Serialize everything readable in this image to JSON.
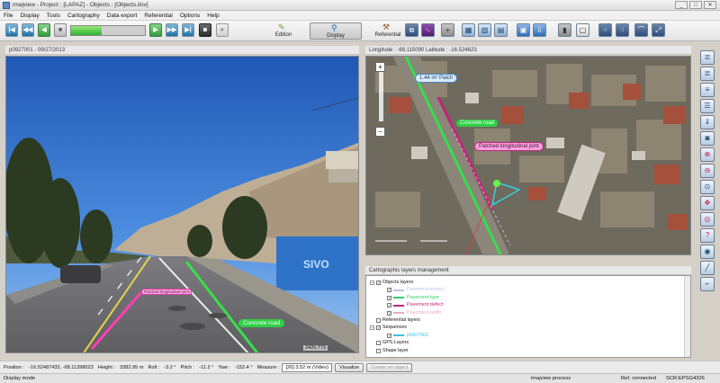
{
  "window": {
    "title": "imajview - Project : [LAPAZ] - Objects : [Objects.ilov]"
  },
  "menu": [
    "File",
    "Display",
    "Tools",
    "Cartography",
    "Data export",
    "Referential",
    "Options",
    "Help"
  ],
  "toolbar": {
    "progress": 0.42,
    "modes": [
      {
        "label": "Edition",
        "icon": "pen-icon"
      },
      {
        "label": "Display",
        "icon": "magnifier-icon"
      },
      {
        "label": "Referential",
        "icon": "hammer-icon"
      }
    ],
    "active_mode": "Display"
  },
  "photo": {
    "header": "p0927001 - 09/27/2013",
    "label_concrete": "Concrete road",
    "label_patched": "Patched longitudinal joint",
    "distance": "2420,773"
  },
  "map": {
    "header": "Longitude : -68.115090 Latitude : -16.524623",
    "label_patch": "1.44 m² Patch",
    "label_concrete": "Concrete road",
    "label_patched": "Patched longitudinal joint",
    "zoom_plus": "+",
    "zoom_minus": "−"
  },
  "layers": {
    "header": "Cartographic layers management",
    "rows": [
      {
        "text": "Objects layers",
        "level": 0,
        "checked": true,
        "expander": "−",
        "color": ""
      },
      {
        "text": "Pavement extract",
        "level": 1,
        "checked": true,
        "expander": "",
        "color": "#b7c6ea"
      },
      {
        "text": "Pavement type",
        "level": 1,
        "checked": true,
        "expander": "",
        "color": "#37d16a"
      },
      {
        "text": "Pavement defect",
        "level": 1,
        "checked": true,
        "expander": "",
        "color": "#c2237c"
      },
      {
        "text": "Pavement width",
        "level": 1,
        "checked": true,
        "expander": "",
        "color": "#ecaac9"
      },
      {
        "text": "Referential layers",
        "level": 0,
        "checked": false,
        "expander": "",
        "color": ""
      },
      {
        "text": "Sequences",
        "level": 0,
        "checked": true,
        "expander": "−",
        "color": ""
      },
      {
        "text": "p0927001",
        "level": 1,
        "checked": true,
        "expander": "",
        "color": "#3bbfe3"
      },
      {
        "text": "GPS Layers",
        "level": 0,
        "checked": false,
        "expander": "",
        "color": ""
      },
      {
        "text": "Shape layer",
        "level": 0,
        "checked": false,
        "expander": "",
        "color": ""
      }
    ]
  },
  "status": {
    "position_label": "Position :",
    "position_value": "-16.52487433, -68.11398023",
    "height_label": "Height :",
    "height_value": "3382.95 m",
    "roll_label": "Roll :",
    "roll_value": "-3.2 °",
    "pitch_label": "Pitch :",
    "pitch_value": "-11.2 °",
    "yaw_label": "Yaw :",
    "yaw_value": "-152.4 °",
    "measure_label": "Measure :",
    "measure_value": "[20] 3.52 m (Video)",
    "visualize": "Visualize",
    "create_object": "Create an object"
  },
  "footer": {
    "mode": "Display mode",
    "process": "imajview process",
    "ref": "Ref. connected",
    "scr": "SCR:EPSG4326"
  }
}
